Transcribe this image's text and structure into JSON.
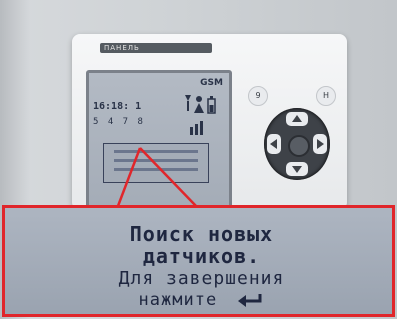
{
  "device": {
    "brand": "ПАНЕЛЬ",
    "lcd": {
      "gsm": "GSM",
      "clock": "16:18:  1",
      "sensors_row": "5 4 7 8"
    },
    "buttons": {
      "left_top": "9",
      "right_top": "H"
    }
  },
  "zoom": {
    "line1": "Поиск новых",
    "line2": "датчиков.",
    "line3": "Для завершения",
    "line4": "нажмите"
  },
  "icons": [
    "enter-icon",
    "antenna-icon",
    "person-icon",
    "battery-icon"
  ],
  "colors": {
    "callout": "#e0262b",
    "lcd_text": "#1f2740",
    "lcd_bg": "#a4acb7"
  }
}
